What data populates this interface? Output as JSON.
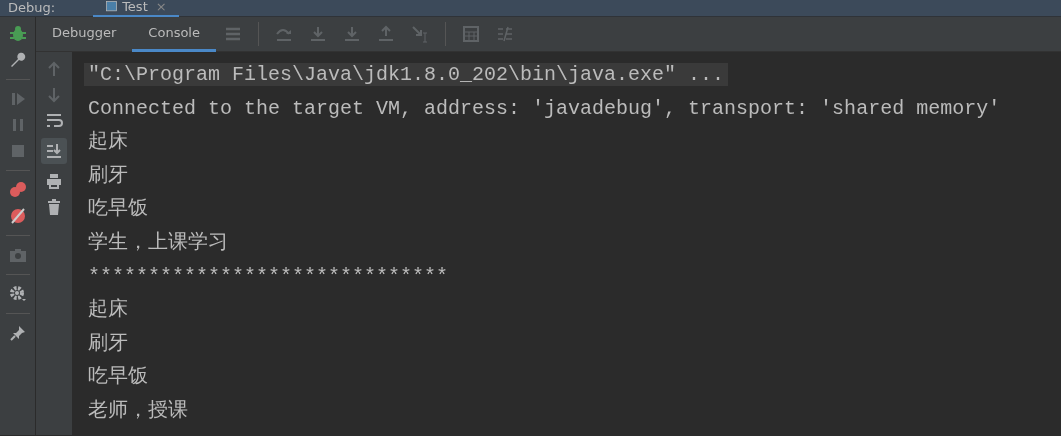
{
  "debug_bar": {
    "label": "Debug:",
    "tabs": [
      {
        "label": "Test",
        "selected": true,
        "close": "×"
      }
    ]
  },
  "tool_tabs": [
    {
      "label": "Debugger",
      "selected": false
    },
    {
      "label": "Console",
      "selected": true
    }
  ],
  "scroll_to_end": {
    "on": true
  },
  "console": {
    "lines": [
      {
        "kind": "command",
        "text": "\"C:\\Program Files\\Java\\jdk1.8.0_202\\bin\\java.exe\" ..."
      },
      {
        "kind": "output",
        "text": "Connected to the target VM, address: 'javadebug', transport: 'shared memory'"
      },
      {
        "kind": "output",
        "text": "起床"
      },
      {
        "kind": "output",
        "text": "刷牙"
      },
      {
        "kind": "output",
        "text": "吃早饭"
      },
      {
        "kind": "output",
        "text": "学生，上课学习"
      },
      {
        "kind": "output",
        "text": "******************************"
      },
      {
        "kind": "output",
        "text": "起床"
      },
      {
        "kind": "output",
        "text": "刷牙"
      },
      {
        "kind": "output",
        "text": "吃早饭"
      },
      {
        "kind": "output",
        "text": "老师，授课"
      }
    ]
  }
}
